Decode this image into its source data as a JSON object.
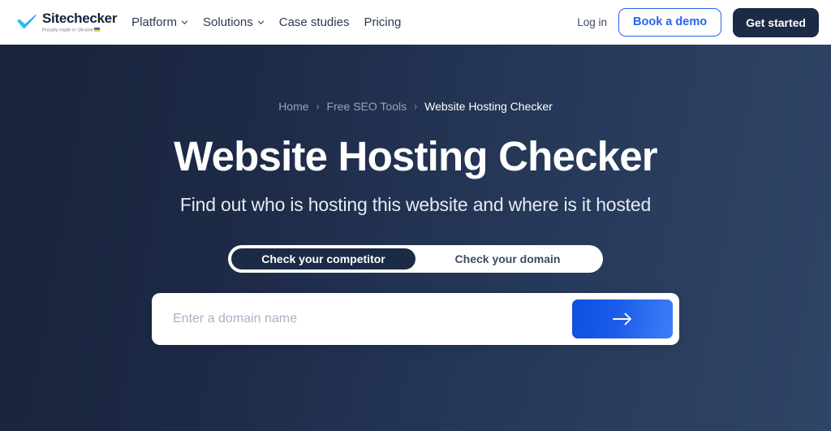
{
  "header": {
    "logo": {
      "name": "Sitechecker",
      "tagline": "Proudly made in Ukraine",
      "check_icon": "check-icon",
      "flag_icon": "ukraine-flag-icon"
    },
    "nav": [
      {
        "label": "Platform",
        "has_chevron": true
      },
      {
        "label": "Solutions",
        "has_chevron": true
      },
      {
        "label": "Case studies",
        "has_chevron": false
      },
      {
        "label": "Pricing",
        "has_chevron": false
      }
    ],
    "login_label": "Log in",
    "demo_label": "Book a demo",
    "get_started_label": "Get started"
  },
  "hero": {
    "breadcrumb": {
      "items": [
        "Home",
        "Free SEO Tools"
      ],
      "separator": "›",
      "current": "Website Hosting Checker"
    },
    "title": "Website Hosting Checker",
    "subtitle": "Find out who is hosting this website and where is it hosted",
    "toggle": {
      "options": [
        "Check your competitor",
        "Check your domain"
      ],
      "active_index": 0
    },
    "search": {
      "placeholder": "Enter a domain name",
      "value": "",
      "submit_icon": "arrow-right-icon"
    }
  },
  "colors": {
    "brand_blue": "#2563f0",
    "dark_navy": "#1b2a45",
    "hero_gradient_start": "#19243c",
    "hero_gradient_end": "#2f4566",
    "submit_gradient_start": "#0f4fdf",
    "submit_gradient_end": "#3f7ef7",
    "logo_check_cyan": "#27c3f0"
  }
}
